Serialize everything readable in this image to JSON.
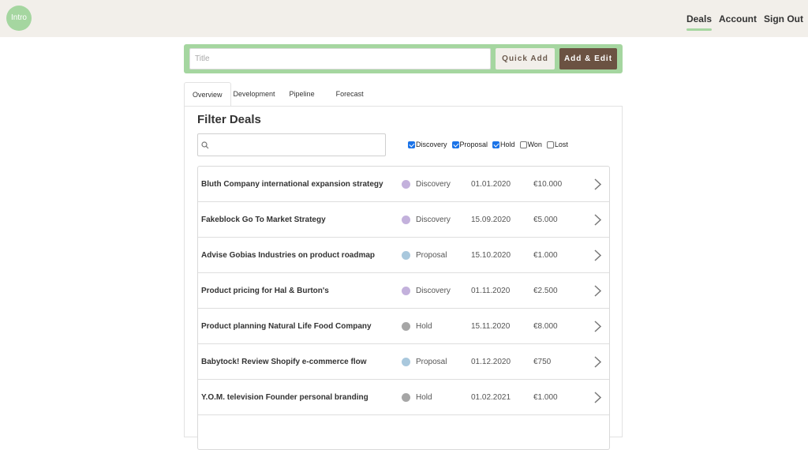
{
  "header": {
    "logo_text": "Intro",
    "nav": [
      {
        "label": "Deals",
        "active": true
      },
      {
        "label": "Account",
        "active": false
      },
      {
        "label": "Sign Out",
        "active": false
      }
    ]
  },
  "add_bar": {
    "title_placeholder": "Title",
    "quick_add_label": "Quick Add",
    "add_edit_label": "Add & Edit"
  },
  "tabs": [
    {
      "label": "Overview",
      "active": true
    },
    {
      "label": "Development",
      "active": false
    },
    {
      "label": "Pipeline",
      "active": false
    },
    {
      "label": "Forecast",
      "active": false
    }
  ],
  "filter": {
    "title": "Filter Deals",
    "search_value": "",
    "checkboxes": [
      {
        "label": "Discovery",
        "checked": true
      },
      {
        "label": "Proposal",
        "checked": true
      },
      {
        "label": "Hold",
        "checked": true
      },
      {
        "label": "Won",
        "checked": false
      },
      {
        "label": "Lost",
        "checked": false
      }
    ]
  },
  "stage_colors": {
    "Discovery": "#c3b1dc",
    "Proposal": "#a9c8dd",
    "Hold": "#a6a6a6"
  },
  "colors": {
    "accent": "#a5d6a0",
    "header_bg": "#f2efea",
    "primary_button": "#6b5242"
  },
  "deals": [
    {
      "name": "Bluth Company international expansion strategy",
      "stage": "Discovery",
      "date": "01.01.2020",
      "amount": "€10.000"
    },
    {
      "name": "Fakeblock Go To Market Strategy",
      "stage": "Discovery",
      "date": "15.09.2020",
      "amount": "€5.000"
    },
    {
      "name": "Advise Gobias Industries on product roadmap",
      "stage": "Proposal",
      "date": "15.10.2020",
      "amount": "€1.000"
    },
    {
      "name": "Product pricing for Hal & Burton's",
      "stage": "Discovery",
      "date": "01.11.2020",
      "amount": "€2.500"
    },
    {
      "name": "Product planning Natural Life Food Company",
      "stage": "Hold",
      "date": "15.11.2020",
      "amount": "€8.000"
    },
    {
      "name": "Babytock! Review Shopify e-commerce flow",
      "stage": "Proposal",
      "date": "01.12.2020",
      "amount": "€750"
    },
    {
      "name": "Y.O.M. television Founder personal branding",
      "stage": "Hold",
      "date": "01.02.2021",
      "amount": "€1.000"
    }
  ]
}
